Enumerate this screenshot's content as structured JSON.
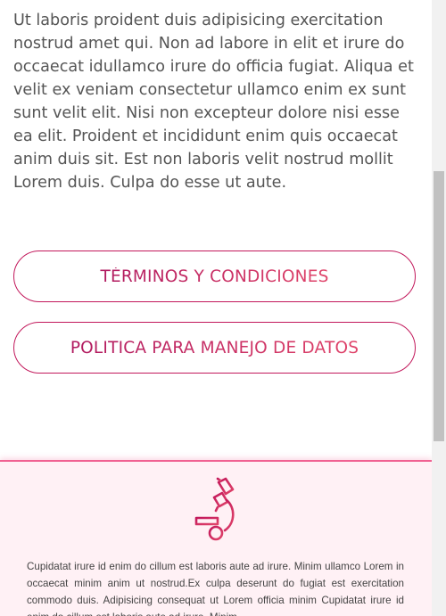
{
  "intro": {
    "text": "Ut laboris proident duis adipisicing exercitation nostrud amet qui. Non ad labore in elit et irure do occaecat idullamco irure do officia fugiat. Aliqua et velit ex veniam consectetur ullamco enim ex sunt sunt velit elit. Nisi non excepteur dolore nisi esse ea elit. Proident et incididunt enim quis occaecat anim duis sit. Est non laboris velit nostrud mollit Lorem duis. Culpa do esse ut aute."
  },
  "buttons": {
    "terms_label": "TÉRMINOS Y CONDICIONES",
    "data_policy_label": "POLITICA PARA MANEJO DE DATOS"
  },
  "footer": {
    "icon": "microscope-icon",
    "text": "Cupidatat irure id enim do cillum est laboris aute ad irure. Minim ullamco Lorem in occaecat minim anim ut nostrud.Ex culpa deserunt do fugiat est exercitation commodo duis. Adipisicing consequat ut Lorem officia minim Cupidatat irure id enim do cillum est laboris aute ad irure. Minim"
  },
  "colors": {
    "accent": "#c2185b",
    "accent_light": "#e0446a",
    "footer_bg": "#fff1f5",
    "footer_border": "#f06292",
    "body_text": "#555555"
  }
}
